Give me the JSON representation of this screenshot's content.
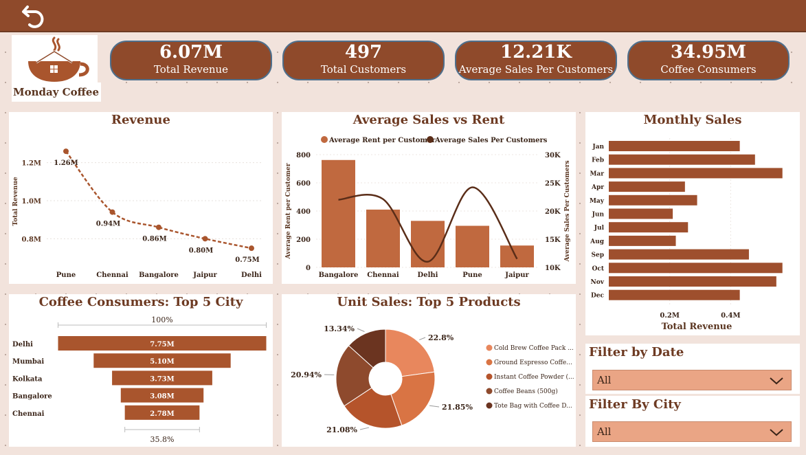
{
  "header": {
    "back_icon": "back-arrow-icon"
  },
  "brand": {
    "name": "Monday Coffee",
    "logo_icon": "coffee-cup-house-logo"
  },
  "kpis": [
    {
      "value": "6.07M",
      "label": "Total Revenue"
    },
    {
      "value": "497",
      "label": "Total Customers"
    },
    {
      "value": "12.21K",
      "label": "Average Sales Per Customers"
    },
    {
      "value": "34.95M",
      "label": "Coffee Consumers"
    }
  ],
  "colors": {
    "brand": "#8f4a2b",
    "bar": "#c0693f",
    "line": "#5a2d18"
  },
  "chart_data": [
    {
      "type": "line",
      "title": "Revenue",
      "ylabel": "Total Revenue",
      "categories": [
        "Pune",
        "Chennai",
        "Bangalore",
        "Jaipur",
        "Delhi"
      ],
      "values": [
        1.26,
        0.94,
        0.86,
        0.8,
        0.75
      ],
      "data_labels": [
        "1.26M",
        "0.94M",
        "0.86M",
        "0.80M",
        "0.75M"
      ],
      "yticks": [
        "0.8M",
        "1.0M",
        "1.2M"
      ],
      "ytick_values": [
        0.8,
        1.0,
        1.2
      ],
      "ylim": [
        0.7,
        1.3
      ]
    },
    {
      "type": "bar",
      "title": "Average Sales vs Rent",
      "categories": [
        "Bangalore",
        "Chennai",
        "Delhi",
        "Pune",
        "Jaipur"
      ],
      "ylabel": "Average Rent per Customer",
      "y2label": "Average Sales Per Customers",
      "series": [
        {
          "name": "Average Rent per Customer",
          "kind": "bar",
          "values": [
            762,
            410,
            330,
            295,
            155
          ]
        },
        {
          "name": "Average Sales Per Customers",
          "kind": "line",
          "values": [
            22000,
            22100,
            11000,
            24200,
            11500
          ]
        }
      ],
      "yticks": [
        "0",
        "200",
        "400",
        "600",
        "800"
      ],
      "y2ticks": [
        "10K",
        "15K",
        "20K",
        "25K",
        "30K"
      ],
      "ylim": [
        0,
        800
      ],
      "y2lim": [
        10000,
        30000
      ],
      "legend": "top"
    },
    {
      "type": "bar",
      "orientation": "horizontal",
      "title": "Monthly Sales",
      "xlabel": "Total Revenue",
      "categories": [
        "Jan",
        "Feb",
        "Mar",
        "Apr",
        "May",
        "Jun",
        "Jul",
        "Aug",
        "Sep",
        "Oct",
        "Nov",
        "Dec"
      ],
      "values": [
        0.43,
        0.48,
        0.57,
        0.25,
        0.29,
        0.21,
        0.26,
        0.22,
        0.46,
        0.57,
        0.55,
        0.43
      ],
      "xticks": [
        "0.2M",
        "0.4M"
      ],
      "xtick_values": [
        0.2,
        0.4
      ],
      "xlim": [
        0,
        0.6
      ]
    },
    {
      "type": "bar",
      "subtype": "funnel",
      "title": "Coffee Consumers: Top 5 City",
      "categories": [
        "Delhi",
        "Mumbai",
        "Kolkata",
        "Bangalore",
        "Chennai"
      ],
      "values": [
        7.75,
        5.1,
        3.73,
        3.08,
        2.78
      ],
      "data_labels": [
        "7.75M",
        "5.10M",
        "3.73M",
        "3.08M",
        "2.78M"
      ],
      "top_pct": "100%",
      "bottom_pct": "35.8%"
    },
    {
      "type": "pie",
      "subtype": "donut",
      "title": "Unit Sales: Top 5 Products",
      "categories": [
        "Cold Brew Coffee Pack ...",
        "Ground Espresso Coffe...",
        "Instant Coffee Powder (...",
        "Coffee Beans (500g)",
        "Tote Bag with Coffee D..."
      ],
      "values": [
        22.8,
        21.85,
        21.08,
        20.94,
        13.34
      ],
      "data_labels": [
        "22.8%",
        "21.85%",
        "21.08%",
        "20.94%",
        "13.34%"
      ],
      "colors": [
        "#e8875d",
        "#d97444",
        "#b5542b",
        "#8e4a2d",
        "#6b3420"
      ],
      "legend": "right"
    }
  ],
  "filters": {
    "date": {
      "title": "Filter by Date",
      "value": "All"
    },
    "city": {
      "title": "Filter By City",
      "value": "All"
    }
  }
}
